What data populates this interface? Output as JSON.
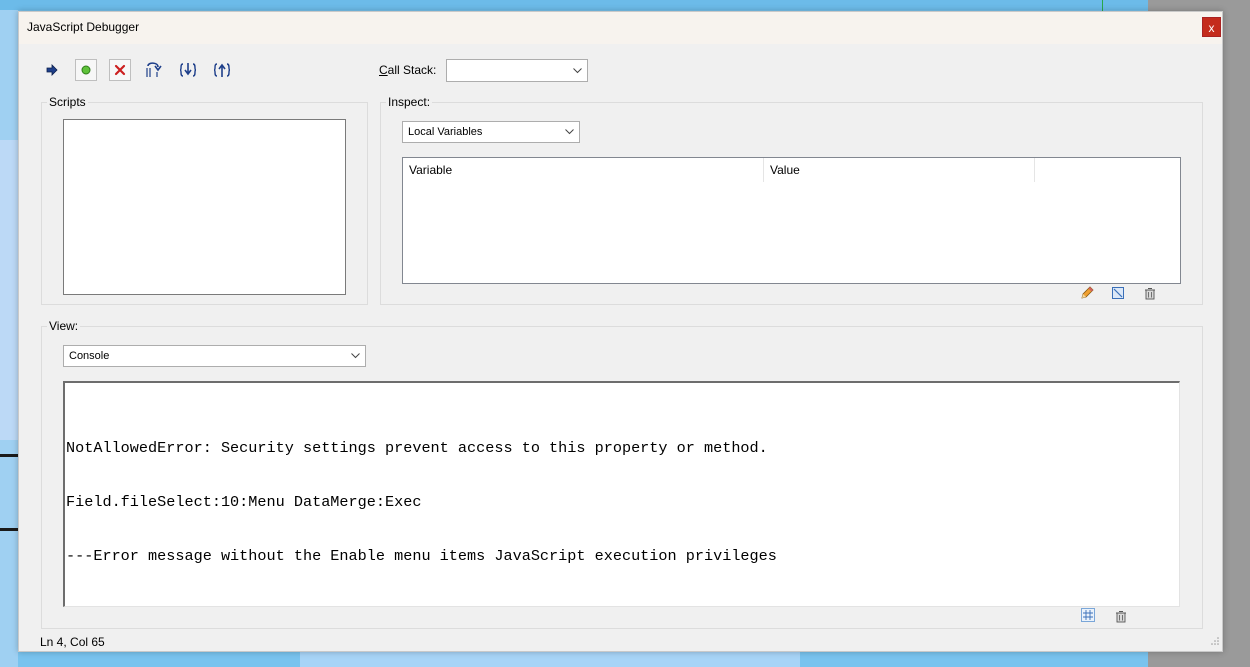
{
  "window": {
    "title": "JavaScript Debugger",
    "close_label": "x"
  },
  "toolbar": {
    "buttons": [
      {
        "name": "resume",
        "icon": "resume-arrow-icon"
      },
      {
        "name": "interrupt",
        "icon": "green-dot-icon"
      },
      {
        "name": "quit",
        "icon": "red-x-icon"
      },
      {
        "name": "step-over",
        "icon": "step-over-icon"
      },
      {
        "name": "step-into",
        "icon": "step-into-icon"
      },
      {
        "name": "step-out",
        "icon": "step-out-icon"
      }
    ]
  },
  "call_stack": {
    "label": "Call Stack:",
    "underline_char": "C",
    "label_rest": "all Stack:",
    "value": ""
  },
  "scripts": {
    "title": "Scripts",
    "items": []
  },
  "inspect": {
    "title": "Inspect:",
    "selected": "Local Variables",
    "columns": [
      "Variable",
      "Value"
    ],
    "rows": [],
    "action_icons": [
      "pencil-icon",
      "watch-icon",
      "trash-icon"
    ]
  },
  "view": {
    "title": "View:",
    "selected": "Console",
    "console_lines": [
      "",
      "NotAllowedError: Security settings prevent access to this property or method.",
      "Field.fileSelect:10:Menu DataMerge:Exec",
      "---Error message without the Enable menu items JavaScript execution privileges"
    ],
    "action_icons": [
      "grid-icon",
      "trash-icon"
    ]
  },
  "status_bar": {
    "position": "Ln 4, Col 65"
  },
  "colors": {
    "close_button": "#c42b1c",
    "window_bg": "#f0f0f0",
    "title_bg": "#f7f3ee"
  }
}
